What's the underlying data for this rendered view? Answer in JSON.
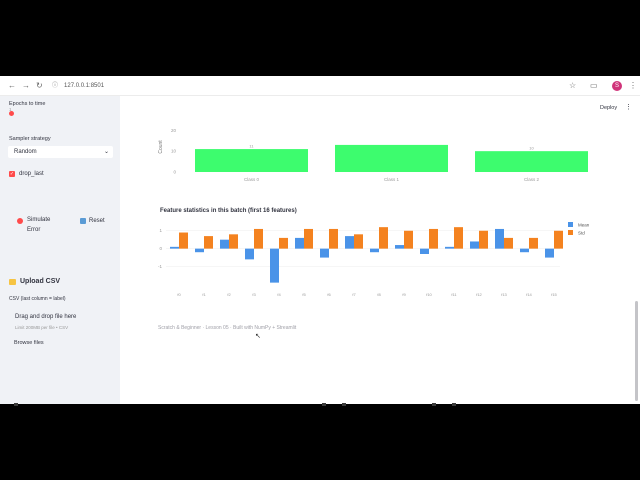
{
  "browser": {
    "back": "←",
    "forward": "→",
    "reload": "↻",
    "lock_icon": "ⓘ",
    "url": "127.0.0.1:8501",
    "avatar_letter": "S"
  },
  "sidebar": {
    "epochs_label": "Epochs to time",
    "epochs_value": "1",
    "sampler_label": "Sampler strategy",
    "sampler_value": "Random",
    "drop_last_label": "drop_last",
    "simulate_line1": "Simulate",
    "simulate_line2": "Error",
    "reset_label": "Reset",
    "upload_title": "Upload CSV",
    "csv_label": "CSV (last column = label)",
    "dropzone_title": "Drag and drop file here",
    "dropzone_hint": "Limit 200MB per file • CSV",
    "browse_label": "Browse files"
  },
  "header": {
    "deploy_label": "Deploy",
    "menu_icon": "⋮"
  },
  "main": {
    "class_chart_ylabel": "Count",
    "stats_title": "Feature statistics in this batch (first 16 features)",
    "footer": "Scratch & Beginner · Lesson 05 · Built with NumPy + Streamlit"
  },
  "colors": {
    "green": "#3dfc6e",
    "mean": "#4a93e8",
    "std": "#f4821f",
    "accent": "#ff4b4b"
  },
  "chart_data": [
    {
      "type": "bar",
      "categories": [
        "Class 0",
        "Class 1",
        "Class 2"
      ],
      "values": [
        11,
        13,
        10
      ],
      "data_labels": [
        "11",
        "",
        "10"
      ],
      "ylabel": "Count",
      "ylim": [
        0,
        24
      ],
      "ytick_labels": [
        "0",
        "10",
        "20"
      ],
      "color": "#3dfc6e"
    },
    {
      "type": "bar",
      "title": "Feature statistics in this batch (first 16 features)",
      "categories": [
        "f0",
        "f1",
        "f2",
        "f3",
        "f4",
        "f5",
        "f6",
        "f7",
        "f8",
        "f9",
        "f10",
        "f11",
        "f12",
        "f13",
        "f14",
        "f15"
      ],
      "series": [
        {
          "name": "Mean",
          "color": "#4a93e8",
          "values": [
            0.1,
            -0.2,
            0.5,
            -0.6,
            -1.9,
            0.6,
            -0.5,
            0.7,
            -0.2,
            0.2,
            -0.3,
            0.1,
            0.4,
            1.1,
            -0.2,
            -0.5
          ]
        },
        {
          "name": "Std",
          "color": "#f4821f",
          "values": [
            0.9,
            0.7,
            0.8,
            1.1,
            0.6,
            1.1,
            1.1,
            0.8,
            1.2,
            1.0,
            1.1,
            1.2,
            1.0,
            0.6,
            0.6,
            1.0
          ]
        }
      ],
      "ylim": [
        -2.2,
        1.6
      ],
      "ytick_labels": [
        "1",
        "0",
        "-1"
      ],
      "legend": "right"
    }
  ]
}
